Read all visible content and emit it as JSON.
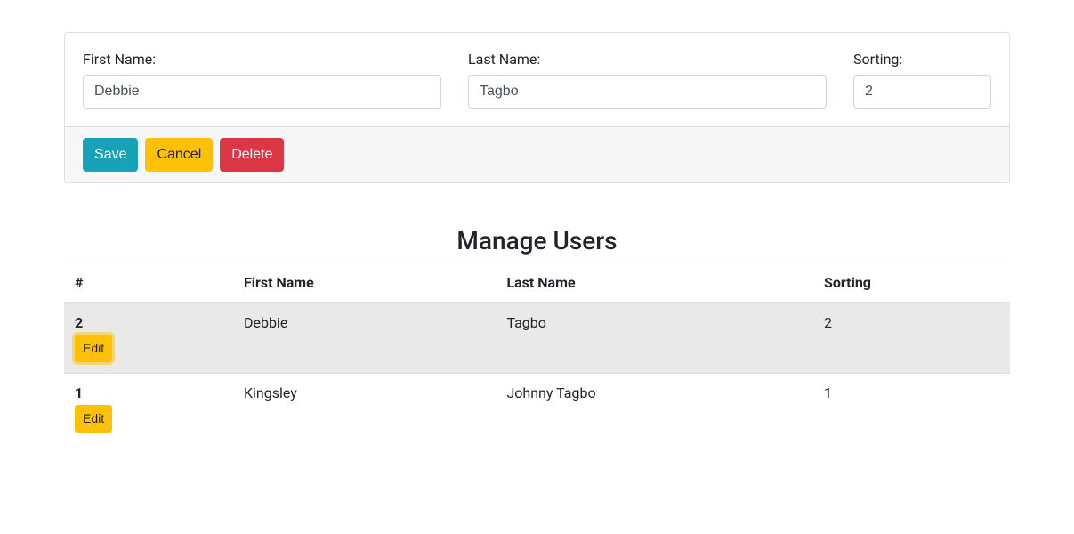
{
  "form": {
    "first_name_label": "First Name:",
    "last_name_label": "Last Name:",
    "sorting_label": "Sorting:",
    "first_name_value": "Debbie",
    "last_name_value": "Tagbo",
    "sorting_value": "2",
    "save_label": "Save",
    "cancel_label": "Cancel",
    "delete_label": "Delete"
  },
  "section": {
    "title": "Manage Users"
  },
  "table": {
    "headers": {
      "id": "#",
      "first_name": "First Name",
      "last_name": "Last Name",
      "sorting": "Sorting"
    },
    "edit_label": "Edit",
    "rows": [
      {
        "id": "2",
        "first_name": "Debbie",
        "last_name": "Tagbo",
        "sorting": "2",
        "selected": true
      },
      {
        "id": "1",
        "first_name": "Kingsley",
        "last_name": "Johnny Tagbo",
        "sorting": "1",
        "selected": false
      }
    ]
  }
}
